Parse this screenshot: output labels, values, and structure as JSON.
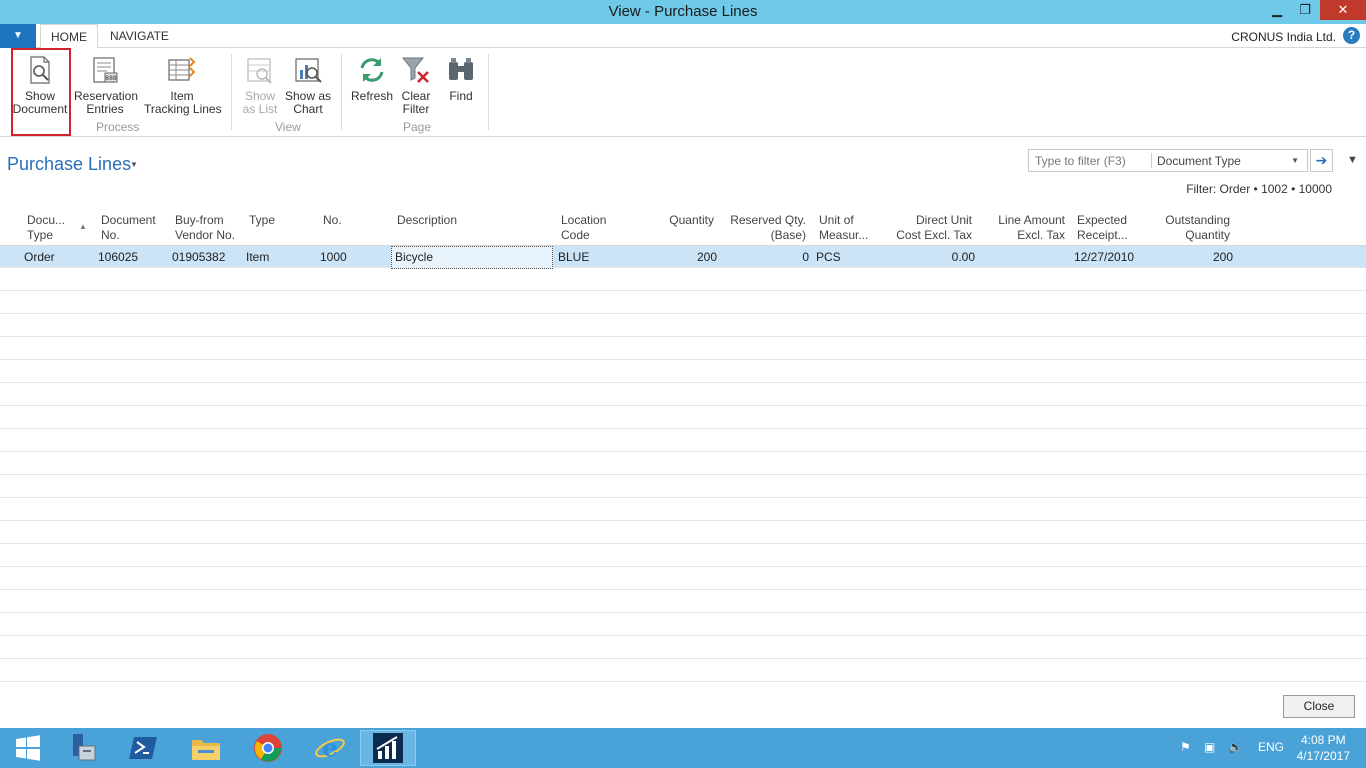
{
  "window": {
    "title": "View - Purchase Lines",
    "minimize_label": "▁",
    "restore_label": "❐",
    "close_label": "✕"
  },
  "ribbon_tabs": {
    "menu_label": "▼",
    "tabs": [
      {
        "label": "HOME"
      },
      {
        "label": "NAVIGATE"
      }
    ],
    "company": "CRONUS India Ltd.",
    "help_label": "?"
  },
  "ribbon": {
    "buttons": {
      "show_document": {
        "line1": "Show",
        "line2": "Document",
        "icon": "show-document-icon"
      },
      "reservation_entries": {
        "line1": "Reservation",
        "line2": "Entries",
        "icon": "reservation-entries-icon"
      },
      "item_tracking_lines": {
        "line1": "Item",
        "line2": "Tracking Lines",
        "icon": "item-tracking-icon"
      },
      "show_as_list": {
        "line1": "Show",
        "line2": "as List",
        "icon": "list-icon"
      },
      "show_as_chart": {
        "line1": "Show as",
        "line2": "Chart",
        "icon": "chart-icon"
      },
      "refresh": {
        "line1": "Refresh",
        "icon": "refresh-icon"
      },
      "clear_filter": {
        "line1": "Clear",
        "line2": "Filter",
        "icon": "clear-filter-icon"
      },
      "find": {
        "line1": "Find",
        "icon": "binoculars-icon"
      }
    },
    "groups": {
      "process": "Process",
      "view": "View",
      "page": "Page"
    }
  },
  "page": {
    "title": "Purchase Lines",
    "filter_placeholder": "Type to filter (F3)",
    "filter_field": "Document Type",
    "filter_text": "Filter: Order • 1002 • 10000"
  },
  "grid": {
    "headers": {
      "doc_type": [
        "Docu...",
        "Type"
      ],
      "doc_no": [
        "Document",
        "No."
      ],
      "vendor": [
        "Buy-from",
        "Vendor No."
      ],
      "type": [
        "Type",
        ""
      ],
      "no": [
        "No.",
        ""
      ],
      "description": [
        "Description",
        ""
      ],
      "location": [
        "Location",
        "Code"
      ],
      "quantity": [
        "Quantity",
        ""
      ],
      "reserved": [
        "Reserved Qty.",
        "(Base)"
      ],
      "uom": [
        "Unit of",
        "Measur..."
      ],
      "unit_cost": [
        "Direct Unit",
        "Cost Excl. Tax"
      ],
      "line_amount": [
        "Line Amount",
        "Excl. Tax"
      ],
      "expected": [
        "Expected",
        "Receipt..."
      ],
      "outstanding": [
        "Outstanding",
        "Quantity"
      ]
    },
    "rows": [
      {
        "doc_type": "Order",
        "doc_no": "106025",
        "vendor": "01905382",
        "type": "Item",
        "no": "1000",
        "description": "Bicycle",
        "location": "BLUE",
        "quantity": "200",
        "reserved": "0",
        "uom": "PCS",
        "unit_cost": "0.00",
        "line_amount": "",
        "expected": "12/27/2010",
        "outstanding": "200"
      }
    ]
  },
  "footer": {
    "close_label": "Close"
  },
  "taskbar": {
    "items": [
      "windows-start-icon",
      "server-manager-icon",
      "powershell-icon",
      "file-explorer-icon",
      "chrome-icon",
      "internet-explorer-icon",
      "dynamics-nav-icon"
    ],
    "language": "ENG",
    "time": "4:08 PM",
    "date": "4/17/2017"
  },
  "colors": {
    "accent": "#2a6ebb",
    "titlebar": "#6fc9e9",
    "taskbar": "#4aa3d8",
    "selected_row": "#cce4f7",
    "highlight": "#d2232a"
  }
}
